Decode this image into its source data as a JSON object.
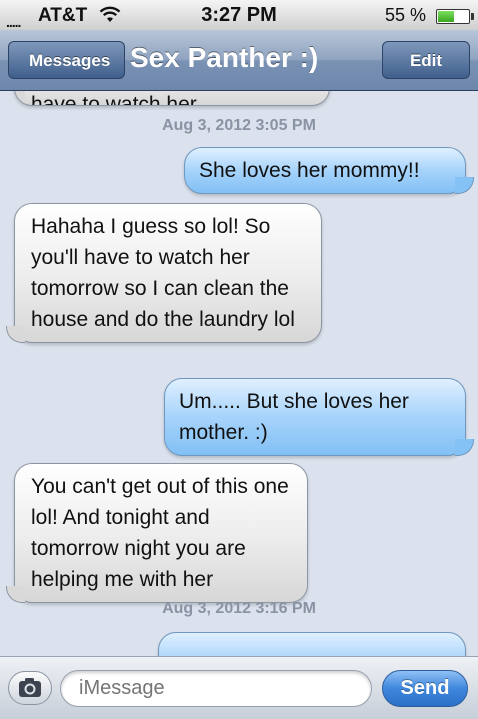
{
  "status_bar": {
    "carrier_signal": ".....",
    "carrier": "AT&T",
    "time": "3:27 PM",
    "battery_percent": "55 %",
    "battery_level": 0.55,
    "wifi_icon": "wifi-icon"
  },
  "nav_bar": {
    "back_label": "Messages",
    "title": "Sex Panther :)",
    "edit_label": "Edit"
  },
  "thread": {
    "timestamps": [
      "Aug 3, 2012 3:05 PM",
      "Aug 3, 2012 3:16 PM"
    ],
    "messages": [
      {
        "direction": "in",
        "text": "Haha I guess so lol! So you'll have to watch her"
      },
      {
        "direction": "out",
        "text": "She loves her mommy!!"
      },
      {
        "direction": "in",
        "text": "Hahaha I guess so lol! So you'll have to watch her tomorrow so I can clean the house and do the laundry lol"
      },
      {
        "direction": "out",
        "text": "Um..... But she loves her mother.  :)"
      },
      {
        "direction": "in",
        "text": "You can't get out of this one lol! And tonight and tomorrow night you are helping me with her"
      },
      {
        "direction": "out",
        "text": ""
      }
    ]
  },
  "input_bar": {
    "camera_icon": "camera-icon",
    "placeholder": "iMessage",
    "send_label": "Send"
  },
  "colors": {
    "outgoing_bubble": "#a6d3fb",
    "incoming_bubble": "#ececec",
    "thread_background": "#dbe2ed",
    "nav_bar": "#6d87ab",
    "send_button": "#3f87dd"
  }
}
